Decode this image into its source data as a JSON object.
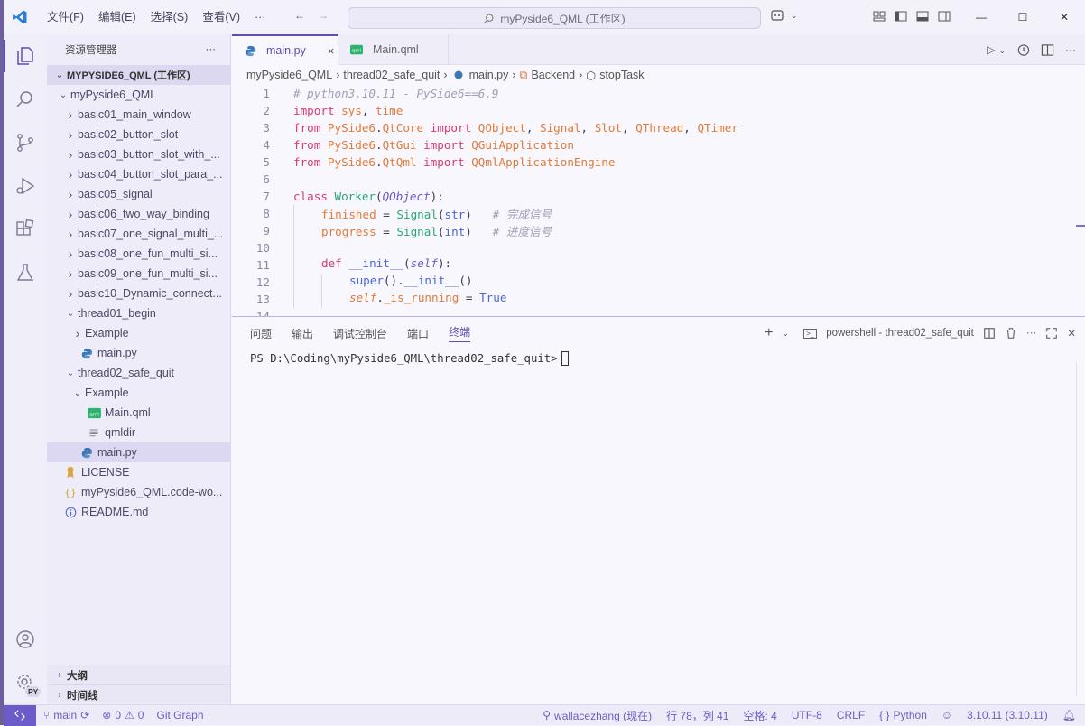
{
  "menu": [
    "文件(F)",
    "编辑(E)",
    "选择(S)",
    "查看(V)",
    "···"
  ],
  "search": {
    "text": "myPyside6_QML (工作区)"
  },
  "colors": {
    "accent": "#5b4fb8",
    "statusbar_remote": "#6b5cc9",
    "python_icon": "#3c78b4",
    "qml_icon": "#2db36b"
  },
  "sidebar": {
    "title": "资源管理器",
    "more": "···",
    "root": "MYPYSIDE6_QML (工作区)",
    "items": [
      {
        "label": "myPyside6_QML",
        "chev": "v",
        "icon": "",
        "level": 1
      },
      {
        "label": "basic01_main_window",
        "chev": ">",
        "icon": "",
        "level": 2
      },
      {
        "label": "basic02_button_slot",
        "chev": ">",
        "icon": "",
        "level": 2
      },
      {
        "label": "basic03_button_slot_with_...",
        "chev": ">",
        "icon": "",
        "level": 2
      },
      {
        "label": "basic04_button_slot_para_...",
        "chev": ">",
        "icon": "",
        "level": 2
      },
      {
        "label": "basic05_signal",
        "chev": ">",
        "icon": "",
        "level": 2
      },
      {
        "label": "basic06_two_way_binding",
        "chev": ">",
        "icon": "",
        "level": 2
      },
      {
        "label": "basic07_one_signal_multi_...",
        "chev": ">",
        "icon": "",
        "level": 2
      },
      {
        "label": "basic08_one_fun_multi_si...",
        "chev": ">",
        "icon": "",
        "level": 2
      },
      {
        "label": "basic09_one_fun_multi_si...",
        "chev": ">",
        "icon": "",
        "level": 2
      },
      {
        "label": "basic10_Dynamic_connect...",
        "chev": ">",
        "icon": "",
        "level": 2
      },
      {
        "label": "thread01_begin",
        "chev": "v",
        "icon": "",
        "level": 2
      },
      {
        "label": "Example",
        "chev": ">",
        "icon": "",
        "level": 3
      },
      {
        "label": "main.py",
        "chev": "",
        "icon": "python",
        "level": 3
      },
      {
        "label": "thread02_safe_quit",
        "chev": "v",
        "icon": "",
        "level": 2
      },
      {
        "label": "Example",
        "chev": "v",
        "icon": "",
        "level": 3
      },
      {
        "label": "Main.qml",
        "chev": "",
        "icon": "qml",
        "level": 4
      },
      {
        "label": "qmldir",
        "chev": "",
        "icon": "lines",
        "level": 4
      },
      {
        "label": "main.py",
        "chev": "",
        "icon": "python",
        "level": 3,
        "selected": true
      },
      {
        "label": "LICENSE",
        "chev": "",
        "icon": "license",
        "level": 2
      },
      {
        "label": "myPyside6_QML.code-wo...",
        "chev": "",
        "icon": "braces",
        "level": 2
      },
      {
        "label": "README.md",
        "chev": "",
        "icon": "info",
        "level": 2
      }
    ],
    "outline": "大纲",
    "timeline": "时间线"
  },
  "tabs": [
    {
      "label": "main.py",
      "icon": "python",
      "active": true,
      "close": "×"
    },
    {
      "label": "Main.qml",
      "icon": "qml",
      "active": false
    }
  ],
  "breadcrumb": [
    "myPyside6_QML",
    "thread02_safe_quit",
    "main.py",
    "Backend",
    "stopTask"
  ],
  "code": {
    "lines": [
      [
        [
          "c-cm",
          "# python3.10.11 - PySide6==6.9"
        ]
      ],
      [
        [
          "c-kw",
          "import "
        ],
        [
          "c-mod",
          "sys"
        ],
        [
          "c-pl",
          ", "
        ],
        [
          "c-mod",
          "time"
        ]
      ],
      [
        [
          "c-kw",
          "from "
        ],
        [
          "c-mod",
          "PySide6"
        ],
        [
          "c-pl",
          "."
        ],
        [
          "c-mod",
          "QtCore"
        ],
        [
          "c-kw",
          " import "
        ],
        [
          "c-mod",
          "QObject"
        ],
        [
          "c-pl",
          ", "
        ],
        [
          "c-mod",
          "Signal"
        ],
        [
          "c-pl",
          ", "
        ],
        [
          "c-mod",
          "Slot"
        ],
        [
          "c-pl",
          ", "
        ],
        [
          "c-mod",
          "QThread"
        ],
        [
          "c-pl",
          ", "
        ],
        [
          "c-mod",
          "QTimer"
        ]
      ],
      [
        [
          "c-kw",
          "from "
        ],
        [
          "c-mod",
          "PySide6"
        ],
        [
          "c-pl",
          "."
        ],
        [
          "c-mod",
          "QtGui"
        ],
        [
          "c-kw",
          " import "
        ],
        [
          "c-mod",
          "QGuiApplication"
        ]
      ],
      [
        [
          "c-kw",
          "from "
        ],
        [
          "c-mod",
          "PySide6"
        ],
        [
          "c-pl",
          "."
        ],
        [
          "c-mod",
          "QtQml"
        ],
        [
          "c-kw",
          " import "
        ],
        [
          "c-mod",
          "QQmlApplicationEngine"
        ]
      ],
      [],
      [
        [
          "c-kw",
          "class "
        ],
        [
          "c-cls",
          "Worker"
        ],
        [
          "c-pl",
          "("
        ],
        [
          "c-par",
          "QObject"
        ],
        [
          "c-pl",
          "):"
        ]
      ],
      [
        [
          "ind1",
          ""
        ],
        [
          "c-attr",
          "finished"
        ],
        [
          "c-pl",
          " = "
        ],
        [
          "c-bi",
          "Signal"
        ],
        [
          "c-pl",
          "("
        ],
        [
          "c-ty",
          "str"
        ],
        [
          "c-pl",
          ")   "
        ],
        [
          "c-cm",
          "# 完成信号"
        ]
      ],
      [
        [
          "ind1",
          ""
        ],
        [
          "c-attr",
          "progress"
        ],
        [
          "c-pl",
          " = "
        ],
        [
          "c-bi",
          "Signal"
        ],
        [
          "c-pl",
          "("
        ],
        [
          "c-ty",
          "int"
        ],
        [
          "c-pl",
          ")   "
        ],
        [
          "c-cm",
          "# 进度信号"
        ]
      ],
      [
        [
          "ind1",
          ""
        ]
      ],
      [
        [
          "ind1",
          ""
        ],
        [
          "c-kw",
          "def "
        ],
        [
          "c-fn",
          "__init__"
        ],
        [
          "c-pl",
          "("
        ],
        [
          "c-par",
          "self"
        ],
        [
          "c-pl",
          "):"
        ]
      ],
      [
        [
          "ind1",
          ""
        ],
        [
          "ind1",
          ""
        ],
        [
          "c-blue",
          "super"
        ],
        [
          "c-pl",
          "()."
        ],
        [
          "c-fn",
          "__init__"
        ],
        [
          "c-pl",
          "()"
        ]
      ],
      [
        [
          "ind1",
          ""
        ],
        [
          "ind1",
          ""
        ],
        [
          "c-self",
          "self"
        ],
        [
          "c-pl",
          "."
        ],
        [
          "c-attr",
          "_is_running"
        ],
        [
          "c-pl",
          " = "
        ],
        [
          "c-blue",
          "True"
        ]
      ],
      []
    ]
  },
  "panel": {
    "tabs": [
      "问题",
      "输出",
      "调试控制台",
      "端口",
      "终端"
    ],
    "active_tab": "终端",
    "terminal_name": "powershell - thread02_safe_quit",
    "prompt": "PS D:\\Coding\\myPyside6_QML\\thread02_safe_quit>"
  },
  "status": {
    "branch": "main",
    "errors": "0",
    "warnings": "0",
    "git_graph": "Git Graph",
    "author": "wallacezhang (现在)",
    "position": "行 78，列 41",
    "spaces": "空格: 4",
    "encoding": "UTF-8",
    "eol": "CRLF",
    "language": "Python",
    "interpreter": "3.10.11 (3.10.11)"
  },
  "account_badge": "PY"
}
